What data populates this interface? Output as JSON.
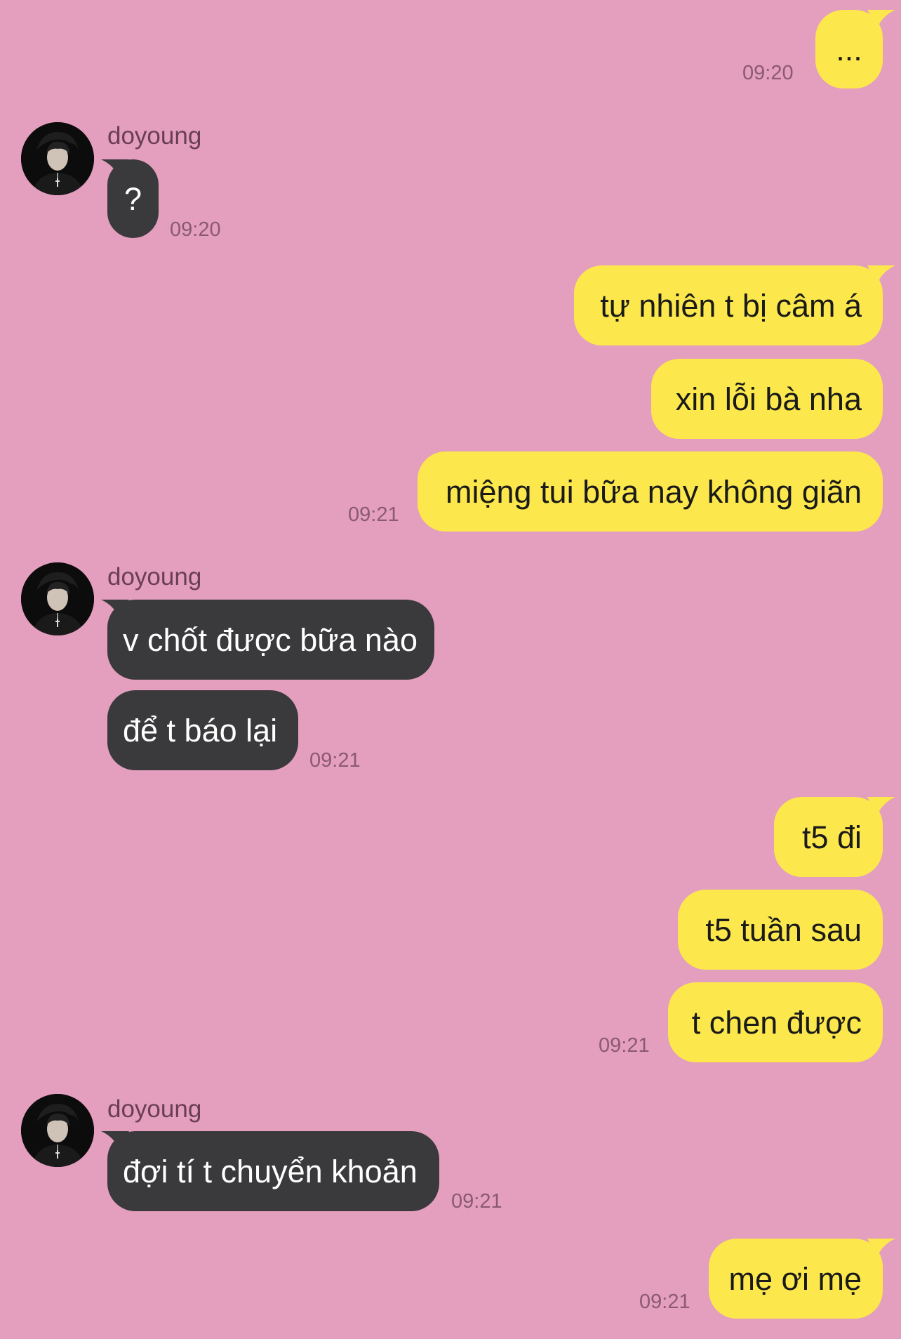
{
  "contact": {
    "name": "doyoung"
  },
  "messages": {
    "m1": {
      "text": "...",
      "time": "09:20"
    },
    "m2": {
      "text": "?",
      "time": "09:20"
    },
    "m3": {
      "text": "tự nhiên t bị câm á"
    },
    "m4": {
      "text": "xin lỗi bà nha"
    },
    "m5": {
      "text": "miệng tui bữa nay không giãn",
      "time": "09:21"
    },
    "m6": {
      "text": "v chốt được bữa nào"
    },
    "m7": {
      "text": "để t báo lại",
      "time": "09:21"
    },
    "m8": {
      "text": "t5 đi"
    },
    "m9": {
      "text": "t5 tuần sau"
    },
    "m10": {
      "text": "t chen được",
      "time": "09:21"
    },
    "m11": {
      "text": "đợi tí t chuyển khoản",
      "time": "09:21"
    },
    "m12": {
      "text": "mẹ ơi mẹ",
      "time": "09:21"
    }
  },
  "colors": {
    "background": "#e49ebe",
    "outgoing_bubble": "#fce84c",
    "incoming_bubble": "#3a3a3c"
  },
  "icons": {
    "avatar": "contact-avatar-photo"
  }
}
